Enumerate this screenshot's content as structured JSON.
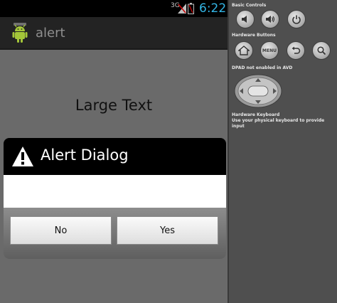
{
  "status_bar": {
    "network": "3G",
    "time": "6:22"
  },
  "action_bar": {
    "title": "alert",
    "icon": "android-icon"
  },
  "content": {
    "large_text": "Large Text"
  },
  "dialog": {
    "title": "Alert Dialog",
    "icon": "warning-icon",
    "message": "",
    "buttons": {
      "negative": "No",
      "positive": "Yes"
    }
  },
  "emulator_controls": {
    "basic_controls_label": "Basic Controls",
    "basic_controls": [
      "volume-down-icon",
      "volume-up-icon",
      "power-icon"
    ],
    "hardware_buttons_label": "Hardware Buttons",
    "hardware_buttons": [
      "home-icon",
      "menu-button",
      "back-icon",
      "search-icon"
    ],
    "menu_label": "MENU",
    "dpad_label": "DPAD not enabled in AVD",
    "keyboard_label": "Hardware Keyboard",
    "keyboard_hint": "Use your physical keyboard to provide input"
  },
  "colors": {
    "status_time": "#33b5e5",
    "screen_background": "#6a6a6a",
    "dialog_header": "#000000",
    "controls_panel": "#4f4f4f"
  }
}
